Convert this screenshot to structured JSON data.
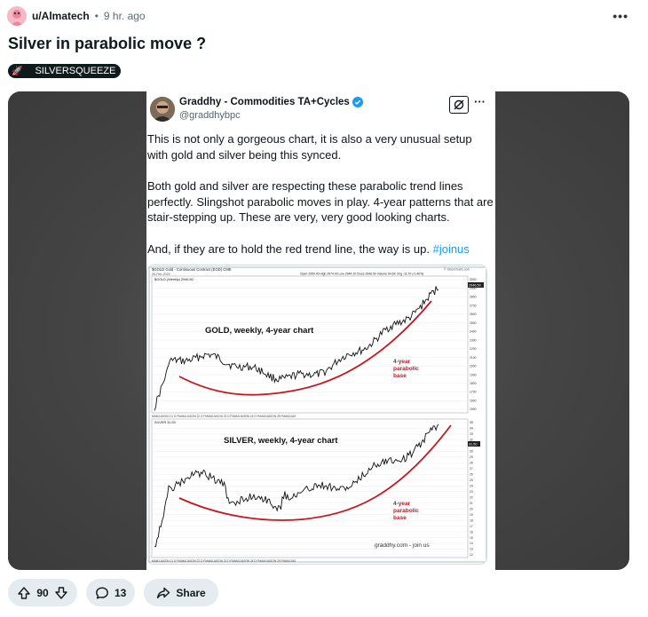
{
  "post": {
    "username": "u/Almatech",
    "separator": "•",
    "time": "9 hr. ago",
    "more_label": "•••",
    "title": "Silver in parabolic move ?",
    "flair": "SILVERSQUEEZE",
    "flair_icon": "rocket-icon"
  },
  "tweet": {
    "author_name": "Graddhy - Commodities TA+Cycles",
    "handle": "@graddhybpc",
    "more_label": "···",
    "para1": "This is not only a gorgeous chart, it is also a very unusual setup with gold and silver being this synced.",
    "para2": "Both gold and silver are respecting these parabolic trend lines perfectly. Slingshot parabolic moves in play. 4-year patterns that are stair-stepping up. These are very, very good looking charts.",
    "para3_prefix": "And, if they are to hold the red trend line, the way is up. ",
    "hashtag": "#joinus"
  },
  "chart_image": {
    "header_left": "$GOLD Gold - Continuous Contract (EOD) CME",
    "header_sub": "26-Feb-2025",
    "header_right": "Open 2950.40  High 2974.00  Low 2944.10  Close 2946.50  Volume 64.6K  Chg -11.70 (-0.40%)",
    "stockcharts": "© StockCharts.com",
    "gold_series_label": "$GOLD (Weekly) 2946.50",
    "silver_series_label": "SILVER 31.50",
    "gold_title": "GOLD, weekly, 4-year chart",
    "silver_title": "SILVER, weekly, 4-year chart",
    "annotation_line1": "4-year",
    "annotation_line2": "parabolic",
    "annotation_line3": "base",
    "watermark": "graddhy.com - join us",
    "gold_last_tag": "2946.50",
    "silver_last_tag": "31.50",
    "gold_axis_ticks": [
      "3000",
      "2900",
      "2800",
      "2700",
      "2600",
      "2500",
      "2400",
      "2300",
      "2200",
      "2100",
      "2000",
      "1900",
      "1800",
      "1700",
      "1600",
      "1500"
    ],
    "silver_axis_ticks": [
      "35",
      "34",
      "33",
      "32",
      "31",
      "30",
      "29",
      "28",
      "27",
      "26",
      "25",
      "24",
      "23",
      "22",
      "21",
      "20",
      "19",
      "18",
      "17",
      "16",
      "15",
      "14",
      "13",
      "12"
    ],
    "x_axis_labels": "MAMJJASON 21 D FMAMJJASON 22 D FMAMJJASON 23 D FMAMJJASON 24 D FMAMJJASON 25 FMAMJJAS"
  },
  "actions": {
    "votes": "90",
    "comments": "13",
    "share": "Share"
  }
}
